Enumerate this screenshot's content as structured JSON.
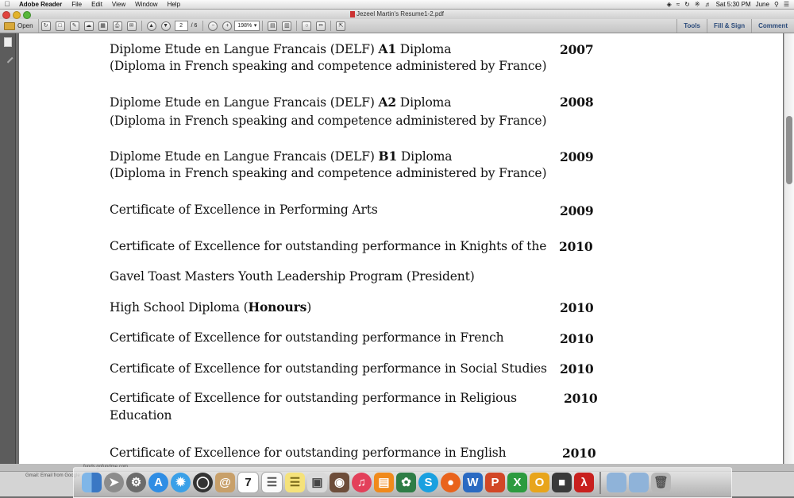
{
  "menubar": {
    "app_name": "Adobe Reader",
    "menus": [
      "File",
      "Edit",
      "View",
      "Window",
      "Help"
    ],
    "clock": "Sat 5:30 PM",
    "user": "June",
    "status_icons": [
      "dropbox-icon",
      "wifi-icon",
      "time-machine-icon",
      "bluetooth-icon",
      "volume-icon"
    ]
  },
  "window": {
    "title": "Jezeel Martin's Resume1-2.pdf"
  },
  "toolbar": {
    "open_label": "Open",
    "page_current": "2",
    "page_total": "/ 6",
    "zoom": "198%",
    "tools_label": "Tools",
    "fill_sign_label": "Fill & Sign",
    "comment_label": "Comment"
  },
  "document": {
    "lines": [
      {
        "pre": "Diplome Etude en Langue Francais (DELF) ",
        "bold": "A1",
        "post": " Diploma",
        "year": "2007"
      },
      {
        "text": "(Diploma in French speaking and competence administered by France)"
      },
      {
        "pre": "Diplome Etude en Langue Francais (DELF) ",
        "bold": "A2",
        "post": " Diploma",
        "year": "2008"
      },
      {
        "text": "(Diploma in French speaking and competence administered by France)"
      },
      {
        "pre": "Diplome Etude en Langue Francais (DELF) ",
        "bold": "B1",
        "post": " Diploma",
        "year": "2009"
      },
      {
        "text": "(Diploma in French speaking and competence administered by France)"
      },
      {
        "text": "Certificate of Excellence in Performing Arts",
        "year": "2009"
      },
      {
        "text": "Certificate of Excellence for outstanding performance in Knights of the",
        "year": "2010"
      },
      {
        "text": "Gavel Toast Masters Youth Leadership Program (President)"
      },
      {
        "pre": "High School Diploma (",
        "bold": "Honours",
        "post": ")",
        "year": "2010"
      },
      {
        "text": "Certificate of Excellence for outstanding performance in French",
        "year": "2010"
      },
      {
        "text": "Certificate of Excellence for outstanding performance in Social Studies",
        "year": "2010"
      },
      {
        "text": "Certificate of Excellence for outstanding performance in Religious",
        "year": "2010"
      },
      {
        "text": " Education"
      },
      {
        "text": "Certificate of Excellence for outstanding performance in English",
        "year": "2010"
      }
    ]
  },
  "background_window": {
    "tab_text": "funds.gofundme.com",
    "bookmark_text": "Gmail: Email from Google"
  },
  "dock": {
    "icons": [
      "finder-icon",
      "launchpad-icon",
      "system-preferences-icon",
      "app-store-icon",
      "safari-icon",
      "dashboard-icon",
      "contacts-icon",
      "calendar-icon",
      "reminders-icon",
      "notes-icon",
      "preview-icon",
      "photo-booth-icon",
      "itunes-icon",
      "ibooks-icon",
      "photos-icon",
      "skype-icon",
      "firefox-icon",
      "word-icon",
      "powerpoint-icon",
      "excel-icon",
      "outlook-icon",
      "unknown-app-icon",
      "adobe-reader-icon",
      "applications-folder-icon",
      "documents-folder-icon",
      "trash-icon"
    ],
    "calendar_day": "7"
  }
}
